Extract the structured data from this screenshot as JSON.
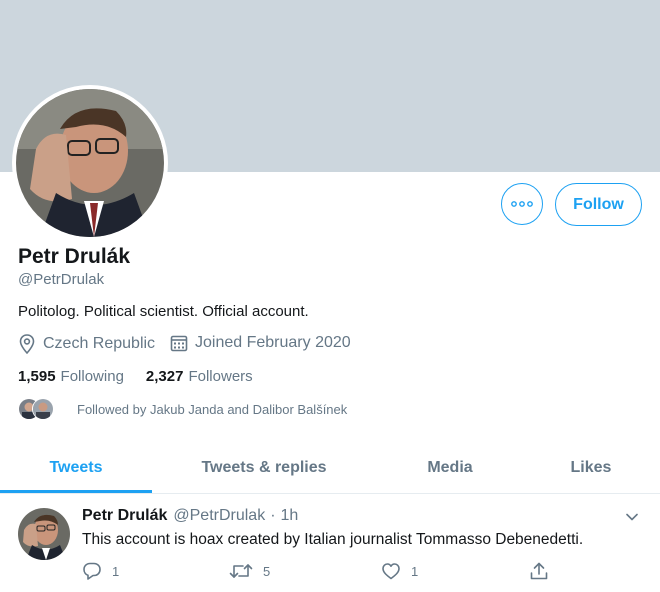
{
  "profile": {
    "name": "Petr Drulák",
    "handle": "@PetrDrulak",
    "bio": "Politolog. Political scientist. Official account.",
    "location": "Czech Republic",
    "joined": "Joined February 2020",
    "following_count": "1,595",
    "following_label": "Following",
    "followers_count": "2,327",
    "followers_label": "Followers",
    "followed_by": "Followed by Jakub Janda and Dalibor Balšínek"
  },
  "actions": {
    "follow_label": "Follow",
    "more_icon": "more-dots-icon"
  },
  "tabs": [
    {
      "label": "Tweets",
      "active": true
    },
    {
      "label": "Tweets & replies",
      "active": false
    },
    {
      "label": "Media",
      "active": false
    },
    {
      "label": "Likes",
      "active": false
    }
  ],
  "tweet": {
    "name": "Petr Drulák",
    "handle": "@PetrDrulak",
    "separator": "·",
    "time": "1h",
    "text": "This account is hoax created by Italian journalist Tommasso Debenedetti.",
    "replies": "1",
    "retweets": "5",
    "likes": "1"
  },
  "colors": {
    "accent": "#1da1f2",
    "banner": "#ccd6dd",
    "secondary_text": "#657786",
    "primary_text": "#14171a"
  }
}
